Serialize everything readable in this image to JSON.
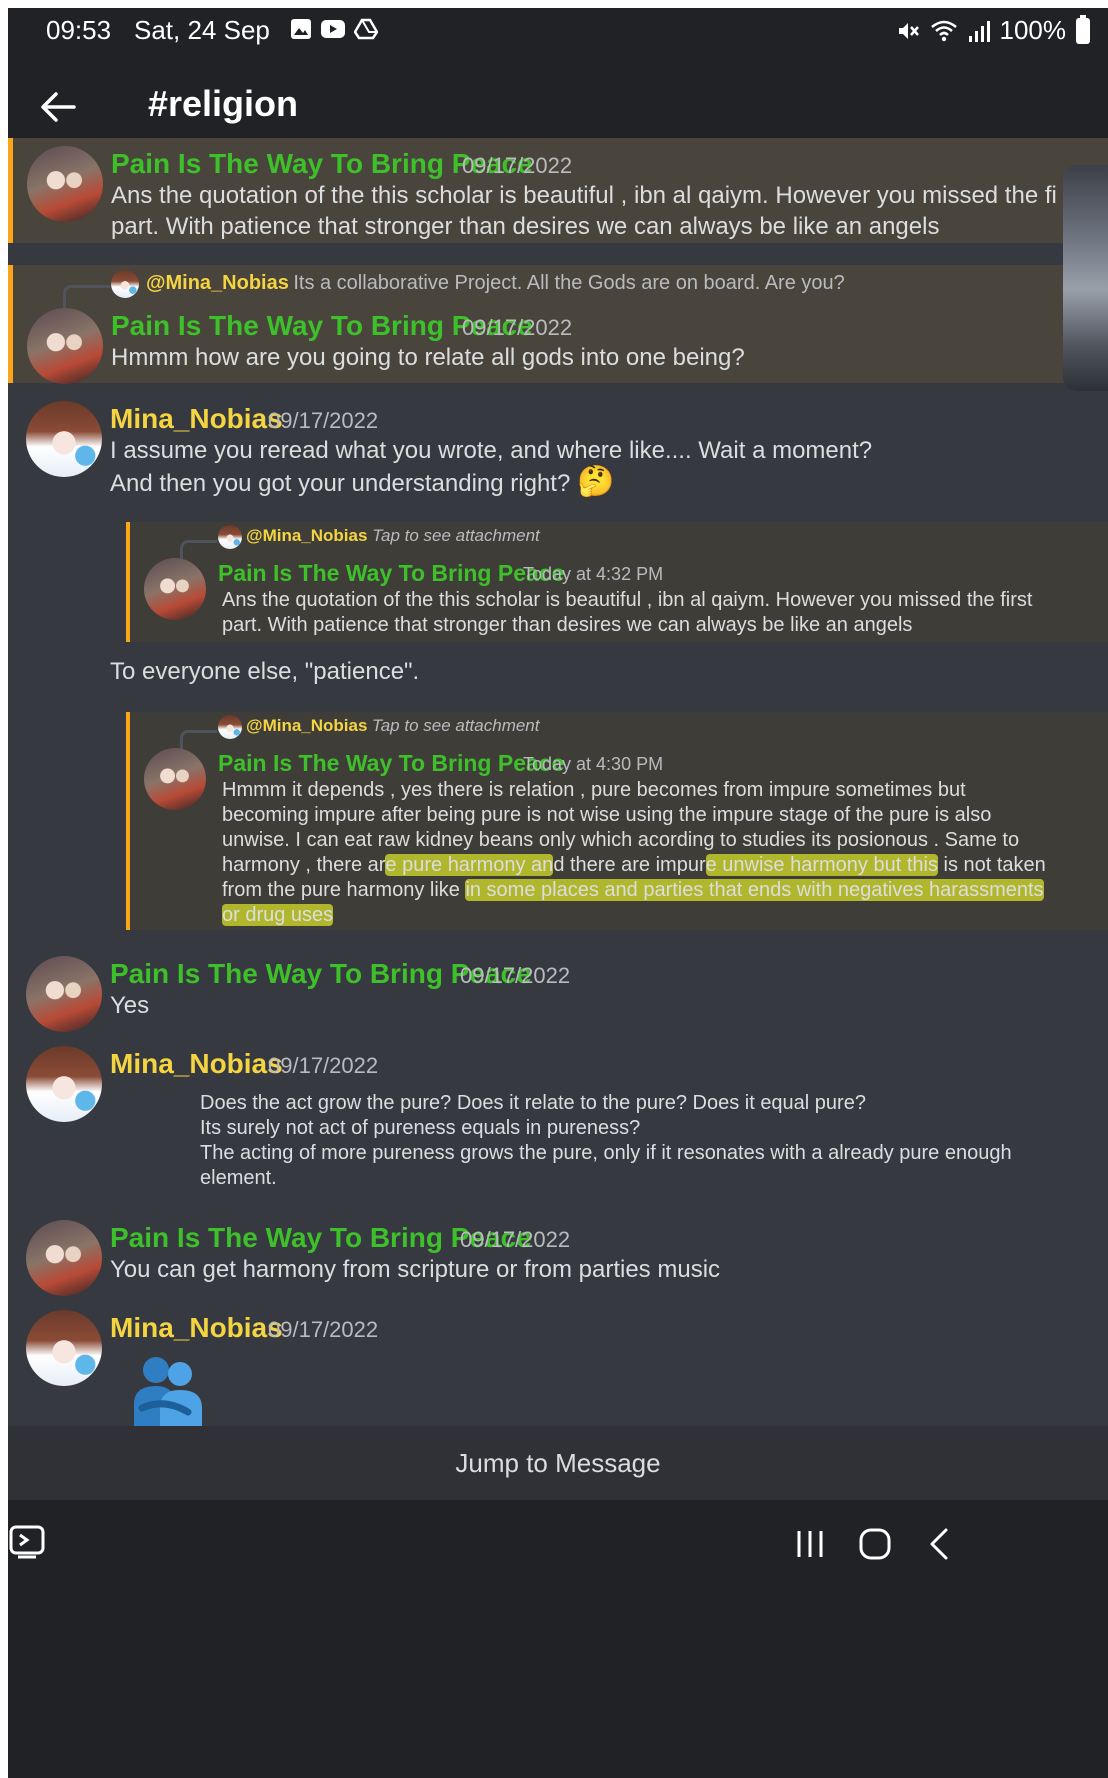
{
  "status_bar": {
    "time": "09:53",
    "date": "Sat, 24 Sep",
    "battery": "100%"
  },
  "channel": {
    "title": "#religion"
  },
  "messages": [
    {
      "author": "Pain Is The Way To Bring Peace",
      "timestamp": "09/17/2022",
      "lines": [
        "Ans the quotation of the this scholar is beautiful , ibn al qaiym. However you missed the fi",
        "part. With patience that stronger than desires  we can always be like an angels"
      ]
    },
    {
      "reply_to": {
        "author": "@Mina_Nobias",
        "text": "Its a collaborative Project. All the Gods are on board.  Are you?"
      },
      "author": "Pain Is The Way To Bring Peace",
      "timestamp": "09/17/2022",
      "lines": [
        "Hmmm how are you going to relate all gods into one being?"
      ]
    },
    {
      "author": "Mina_Nobias",
      "timestamp": "09/17/2022",
      "lines": [
        "I assume you reread what you wrote, and where like.... Wait a moment?",
        "And then you got your understanding right?"
      ],
      "emoji": "🤔",
      "quote1": {
        "reply_author": "@Mina_Nobias",
        "reply_text": "Tap to see attachment",
        "author": "Pain Is The Way To Bring Peace",
        "timestamp": "Today at 4:32 PM",
        "lines": [
          "Ans the quotation of the this scholar is beautiful , ibn al qaiym. However you missed the first",
          "part. With patience that stronger than desires  we can always be like an angels"
        ]
      },
      "after_text": "To everyone else, \"patience\".",
      "quote2": {
        "reply_author": "@Mina_Nobias",
        "reply_text": "Tap to see attachment",
        "author": "Pain Is The Way To Bring Peace",
        "timestamp": "Today at 4:30 PM",
        "line1": "Hmmm it depends , yes there is relation , pure becomes from impure sometimes but",
        "line2": "becoming impure after being pure is not wise using the impure stage of the pure is also",
        "line3": "unwise. I can eat raw kidney beans only which acording to studies its posionous . Same to",
        "line4a": "harmony , there ar",
        "line4b": "e pure harmony an",
        "line4c": "d there are impur",
        "line4d": "e unwise harmony but this",
        "line4e": " is not taken",
        "line5a": "from the pure harmony like ",
        "line5b": "in some places and parties that ends with negatives harassments",
        "line6": "or drug uses"
      }
    },
    {
      "author": "Pain Is The Way To Bring Peace",
      "timestamp": "09/17/2022",
      "lines": [
        "Yes"
      ]
    },
    {
      "author": "Mina_Nobias",
      "timestamp": "09/17/2022",
      "lines": [
        "Does the act grow the pure? Does it relate to the pure? Does it equal pure?",
        "Its surely not act of pureness equals in pureness?",
        "The acting of more pureness grows the pure, only if it resonates with a already pure enough",
        "element."
      ]
    },
    {
      "author": "Pain Is The Way To Bring Peace",
      "timestamp": "09/17/2022",
      "lines": [
        "You can get harmony from scripture or from parties music"
      ]
    },
    {
      "author": "Mina_Nobias",
      "timestamp": "09/17/2022",
      "emoji": "🫂"
    }
  ],
  "jump_bar": {
    "label": "Jump to Message"
  },
  "colors": {
    "background": "#36393f",
    "header": "#202225",
    "highlight": "#49443c",
    "accent_orange": "#faa61a",
    "name_green": "#3ec02a",
    "name_yellow": "#f5d442",
    "marker_yellow": "#dee628"
  },
  "icons": [
    "back-arrow-icon",
    "gallery-icon",
    "youtube-icon",
    "drive-icon",
    "mute-icon",
    "wifi-icon",
    "signal-icon",
    "battery-icon",
    "keyboard-icon",
    "recents-icon",
    "home-icon",
    "back-icon"
  ]
}
